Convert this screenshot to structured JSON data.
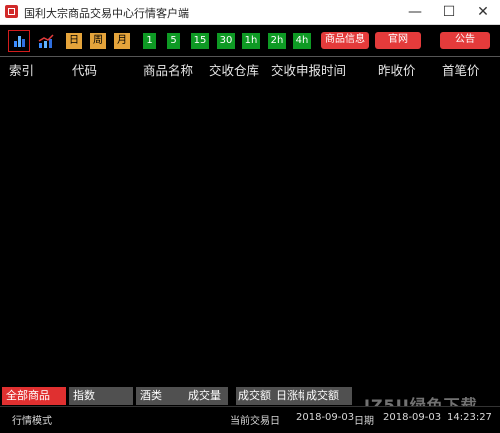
{
  "window": {
    "title": "国利大宗商品交易中心行情客户端",
    "min_glyph": "—",
    "max_glyph": "☐",
    "close_glyph": "✕"
  },
  "toolbar": {
    "periods": [
      "日",
      "周",
      "月"
    ],
    "minutes": [
      "1",
      "5",
      "15",
      "30",
      "1h",
      "2h",
      "4h"
    ],
    "product_info": "商品信息",
    "official_site": "官网",
    "announcement": "公告"
  },
  "table": {
    "columns": [
      "索引",
      "代码",
      "商品名称",
      "交收仓库",
      "交收申报时间",
      "昨收价",
      "首笔价"
    ]
  },
  "tabs": {
    "all_products": "全部商品",
    "index": "指数",
    "liquor": "酒类",
    "volume": "成交量",
    "amount": "成交额",
    "daily_gain": "日涨幅",
    "turnover": "成交额"
  },
  "status": {
    "mode": "行情模式",
    "trade_day_label": "当前交易日",
    "trade_day": "2018-09-03",
    "date_label": "日期",
    "date": "2018-09-03",
    "time": "14:23:27"
  },
  "watermark": "JZ5U绿色下载",
  "colors": {
    "accent_red": "#e03030",
    "period_orange": "#e5a43b",
    "minute_green": "#0e9a24"
  }
}
